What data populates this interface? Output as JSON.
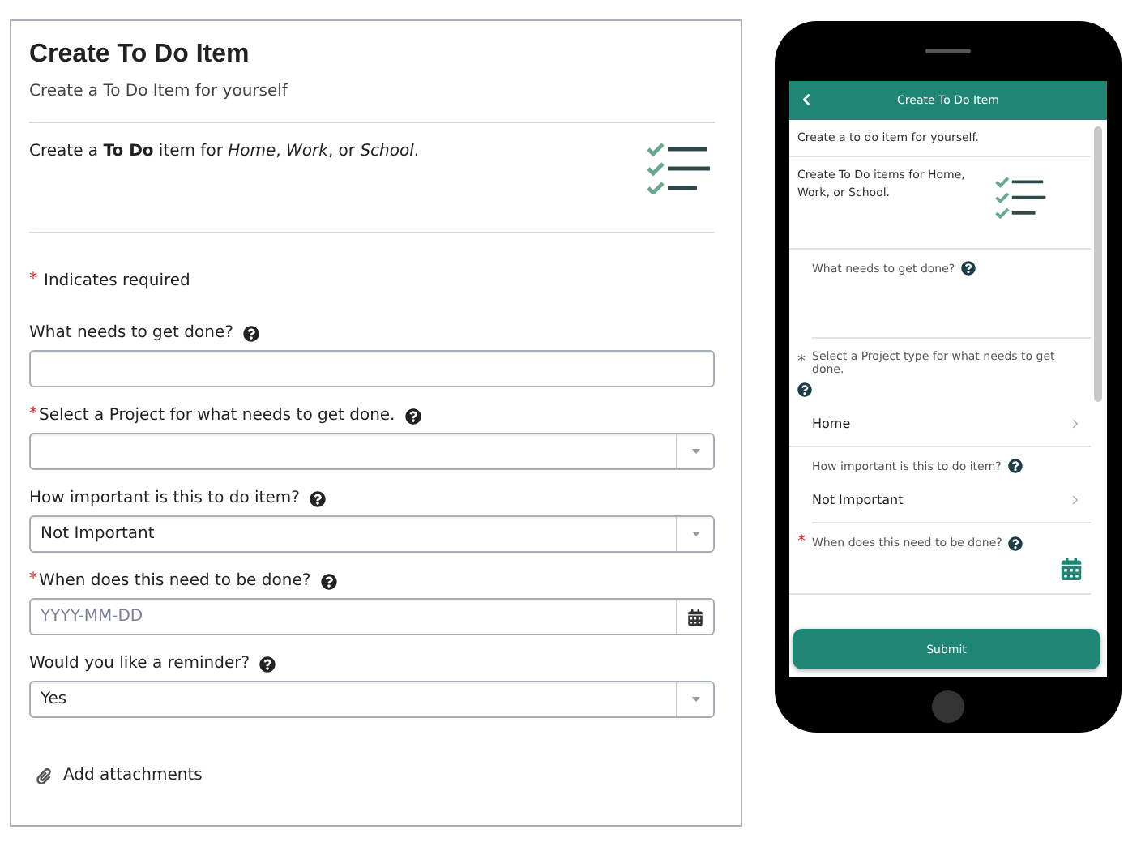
{
  "desktop": {
    "title": "Create To Do Item",
    "subtitle": "Create a To Do Item for yourself",
    "intro": "Create a **To Do** item for *Home*, *Work*, or *School*.",
    "required_mark": "*",
    "required_note": "Indicates required",
    "fields": [
      {
        "kind": "text",
        "label": "What needs to get done?",
        "required": false
      },
      {
        "kind": "select",
        "label": "Select a Project for what needs to get done.",
        "required": true
      },
      {
        "kind": "select",
        "label": "How important is this to do item?",
        "required": false,
        "value": "Not Important"
      },
      {
        "kind": "date",
        "label": "When does this need to be done?",
        "required": true,
        "placeholder": "YYYY-MM-DD"
      },
      {
        "kind": "select",
        "label": "Would you like a reminder?",
        "required": false,
        "value": "Yes"
      }
    ],
    "attachments": "Add attachments"
  },
  "mobile": {
    "title": "Create To Do Item",
    "subtitle": "Create a to do item for yourself.",
    "intro": "Create To Do items for Home, Work, or School.",
    "required_mark": "*",
    "fields": [
      {
        "kind": "text",
        "label": "What needs to get done?",
        "required": false
      },
      {
        "kind": "select",
        "label": "Select a Project type for what needs to get done.",
        "required": true,
        "color": "#555555",
        "value": "Home"
      },
      {
        "kind": "select",
        "label": "How important is this to do item?",
        "required": false,
        "value": "Not Important"
      },
      {
        "kind": "date",
        "label": "When does this need to be done?",
        "required": true,
        "color": "#e02020"
      }
    ],
    "submit": "Submit"
  }
}
